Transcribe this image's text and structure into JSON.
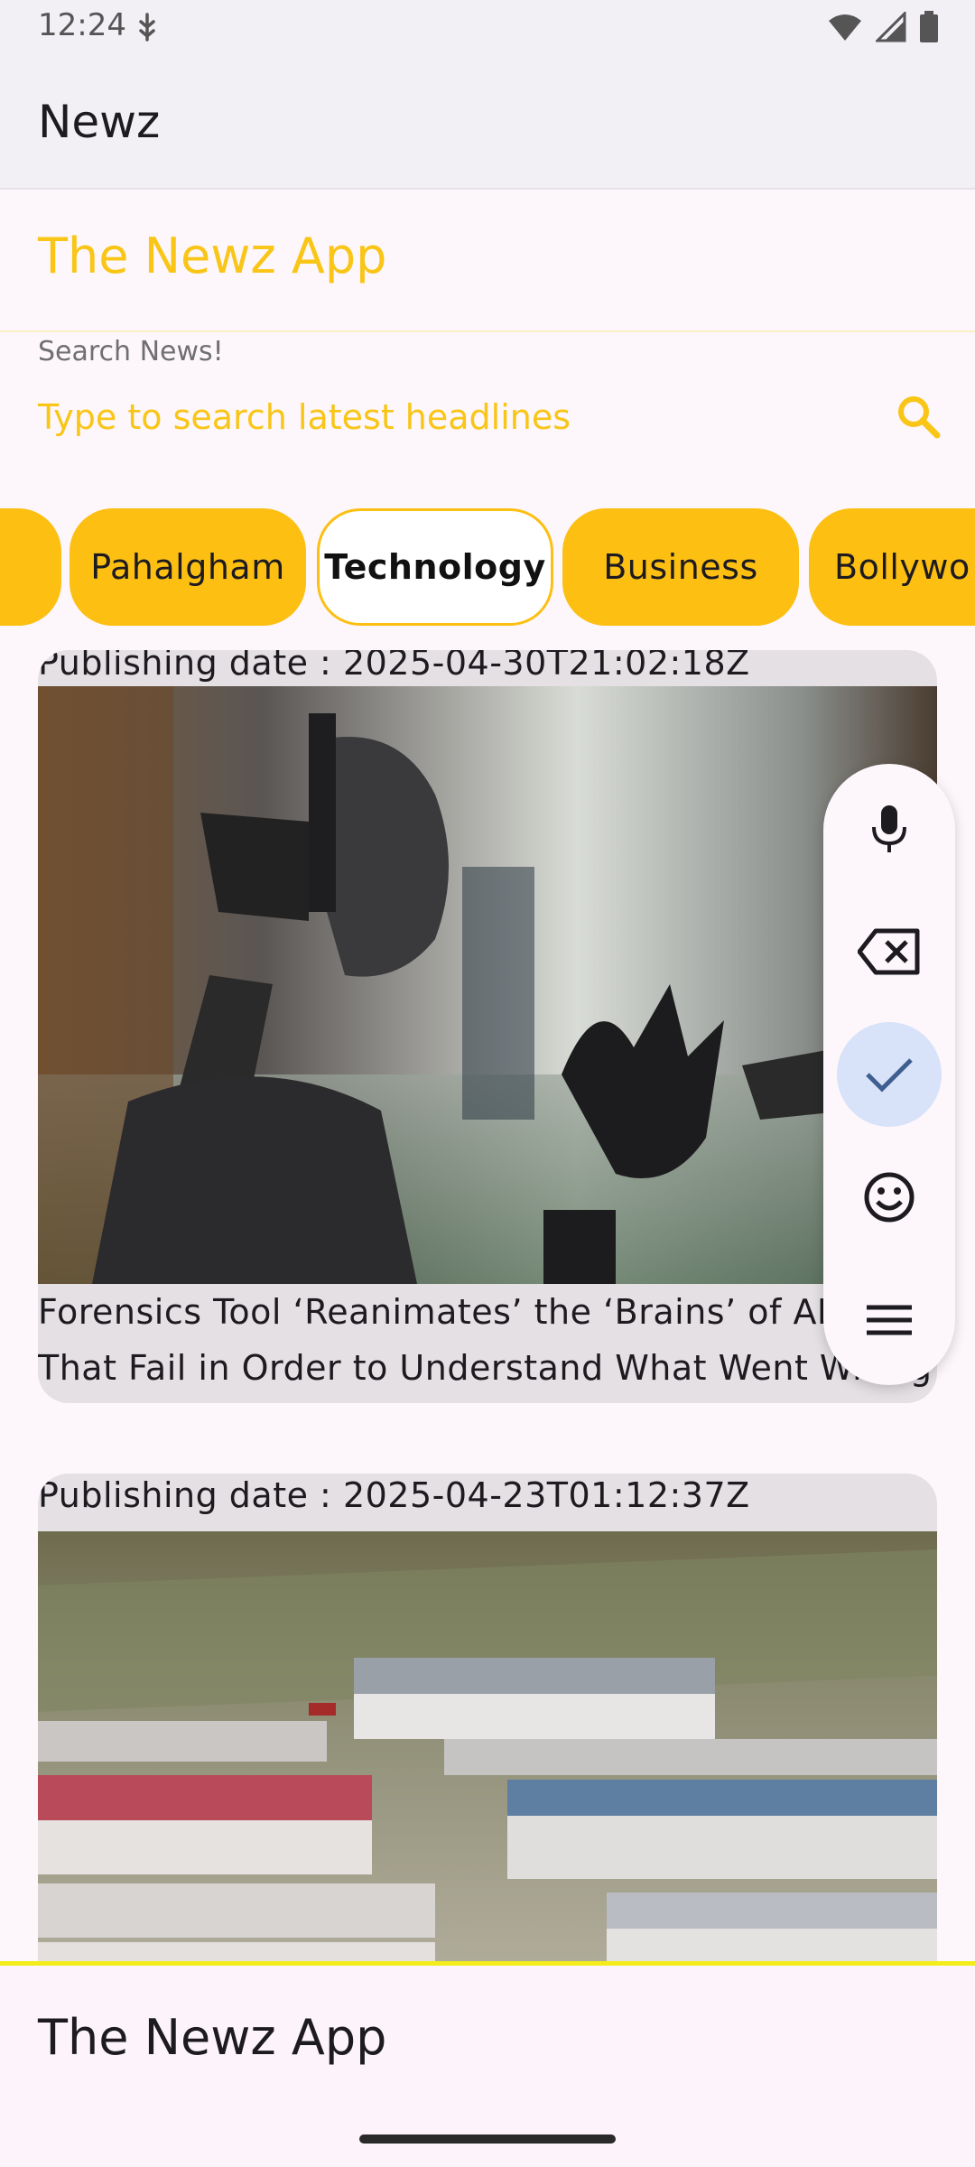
{
  "status_bar": {
    "time": "12:24",
    "icons": [
      "usb-debug-icon",
      "wifi-icon",
      "signal-icon",
      "battery-icon"
    ]
  },
  "appbar": {
    "title": "Newz"
  },
  "header": {
    "brand_title": "The Newz App"
  },
  "search": {
    "label": "Search News!",
    "placeholder": "Type to search latest headlines",
    "icon": "search-icon"
  },
  "categories": {
    "items": [
      {
        "label": ""
      },
      {
        "label": "Pahalgham"
      },
      {
        "label": "Technology",
        "selected": true
      },
      {
        "label": "Business"
      },
      {
        "label": "Bollywo"
      }
    ]
  },
  "articles": [
    {
      "date_label": "Publishing date  : 2025-04-30T21:02:18Z",
      "title_line1": "Forensics Tool ‘Reanimates’ the ‘Brains’ of AIs",
      "title_line2": "That Fail in Order to Understand What Went Wrong"
    },
    {
      "date_label": "Publishing date  : 2025-04-23T01:12:37Z",
      "title_line1": "",
      "title_line2": ""
    }
  ],
  "keyboard_toolbar": {
    "items": [
      "microphone-icon",
      "backspace-icon",
      "check-icon",
      "emoji-icon",
      "menu-icon"
    ],
    "active": "check-icon"
  },
  "bottom_bar": {
    "title": "The Newz App"
  },
  "colors": {
    "accent": "#f9c516",
    "chip": "#fcbf12",
    "surface": "#fdf7fc",
    "appbar": "#f2f0f5",
    "card": "#e4e0e4"
  }
}
